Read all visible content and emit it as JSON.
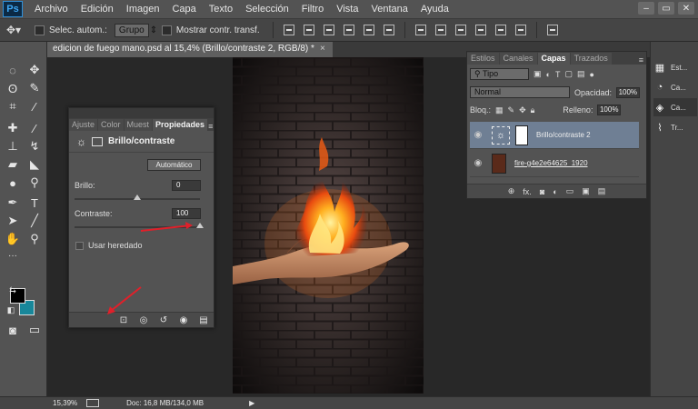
{
  "app": {
    "logo": "Ps"
  },
  "menu": [
    "Archivo",
    "Edición",
    "Imagen",
    "Capa",
    "Texto",
    "Selección",
    "Filtro",
    "Vista",
    "Ventana",
    "Ayuda"
  ],
  "window_controls": [
    "–",
    "▭",
    "✕"
  ],
  "options": {
    "auto_select_label": "Selec. autom.:",
    "group_value": "Grupo",
    "show_transform_label": "Mostrar contr. transf."
  },
  "document": {
    "tab_title": "edicion de fuego mano.psd al 15,4% (Brillo/contraste 2, RGB/8) *",
    "close": "×"
  },
  "properties": {
    "tabs": [
      "Ajuste",
      "Color",
      "Muest",
      "Propiedades"
    ],
    "title": "Brillo/contraste",
    "auto_button": "Automático",
    "brightness_label": "Brillo:",
    "brightness_value": "0",
    "brightness_level": 0.5,
    "contrast_label": "Contraste:",
    "contrast_value": "100",
    "contrast_level": 1.0,
    "legacy_label": "Usar heredado"
  },
  "layers_panel": {
    "tabs": [
      "Estilos",
      "Canales",
      "Capas",
      "Trazados"
    ],
    "filter_value": "Tipo",
    "blend_mode": "Normal",
    "opacity_label": "Opacidad:",
    "opacity_value": "100%",
    "lock_label": "Bloq.:",
    "fill_label": "Relleno:",
    "fill_value": "100%",
    "layers": [
      {
        "name": "Brillo/contraste 2",
        "selected": true
      },
      {
        "name": "fire-g4e2e64625_1920",
        "selected": false
      }
    ],
    "footer_icons": [
      "link-icon",
      "fx-icon",
      "mask-icon",
      "adjustment-icon",
      "folder-icon",
      "new-layer-icon",
      "trash-icon"
    ],
    "footer_fx": "fx."
  },
  "right_dock": [
    {
      "label": "Est...",
      "icon": "styles-icon",
      "selected": false
    },
    {
      "label": "Ca...",
      "icon": "channels-icon",
      "selected": false
    },
    {
      "label": "Ca...",
      "icon": "layers-icon",
      "selected": true
    },
    {
      "label": "Tr...",
      "icon": "paths-icon",
      "selected": false
    }
  ],
  "status": {
    "zoom": "15,39%",
    "doc_info": "Doc: 16,8 MB/134,0 MB"
  },
  "colors": {
    "foreground": "#000000",
    "background": "#18879a",
    "annotation_arrow": "#e0202a"
  }
}
